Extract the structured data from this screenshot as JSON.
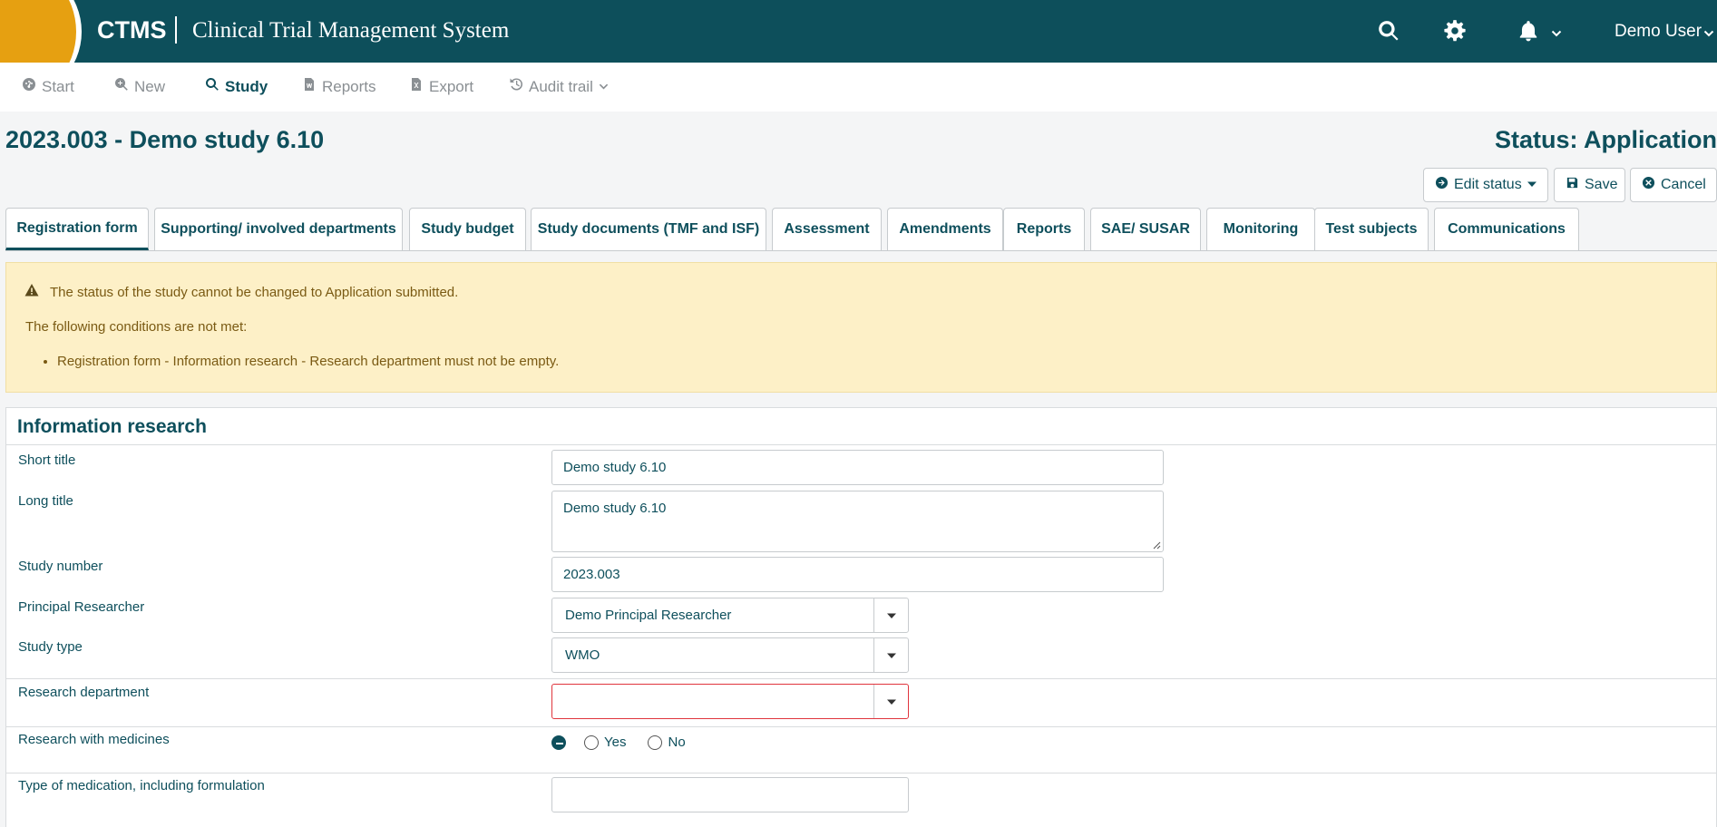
{
  "app": {
    "brand": "CTMS",
    "subtitle": "Clinical Trial Management System",
    "user_name": "Demo User"
  },
  "nav": {
    "items": [
      {
        "label": "Start",
        "icon": "dashboard-icon"
      },
      {
        "label": "New",
        "icon": "search-plus-icon"
      },
      {
        "label": "Study",
        "icon": "search-icon"
      },
      {
        "label": "Reports",
        "icon": "word-file-icon"
      },
      {
        "label": "Export",
        "icon": "excel-file-icon"
      },
      {
        "label": "Audit trail",
        "icon": "history-icon"
      }
    ],
    "active": "Study"
  },
  "page": {
    "title": "2023.003 - Demo study 6.10",
    "status": "Status: Application",
    "buttons": {
      "edit_status": "Edit status",
      "save": "Save",
      "cancel": "Cancel"
    }
  },
  "tabs": [
    "Registration form",
    "Supporting/ involved departments",
    "Study budget",
    "Study documents (TMF and ISF)",
    "Assessment",
    "Amendments",
    "Reports",
    "SAE/ SUSAR",
    "Monitoring",
    "Test subjects",
    "Communications"
  ],
  "alert": {
    "message": "The status of the study cannot be changed to Application submitted.",
    "conditions_intro": "The following conditions are not met:",
    "conditions": [
      "Registration form - Information research - Research department must not be empty."
    ]
  },
  "form": {
    "section_title": "Information research",
    "short_title": {
      "label": "Short title",
      "value": "Demo study 6.10"
    },
    "long_title": {
      "label": "Long title",
      "value": "Demo study 6.10"
    },
    "study_number": {
      "label": "Study number",
      "value": "2023.003"
    },
    "principal_researcher": {
      "label": "Principal Researcher",
      "value": "Demo Principal Researcher"
    },
    "study_type": {
      "label": "Study type",
      "value": "WMO"
    },
    "research_department": {
      "label": "Research department",
      "value": ""
    },
    "research_with_medicines": {
      "label": "Research with medicines",
      "options": [
        "Yes",
        "No"
      ]
    },
    "type_of_medication": {
      "label": "Type of medication, including formulation",
      "value": ""
    }
  },
  "colors": {
    "header_bg": "#0d4f5b",
    "accent": "#e6a011",
    "text": "#0e4f5c",
    "alert_bg": "#fdf0c7",
    "error": "#e0353d"
  }
}
